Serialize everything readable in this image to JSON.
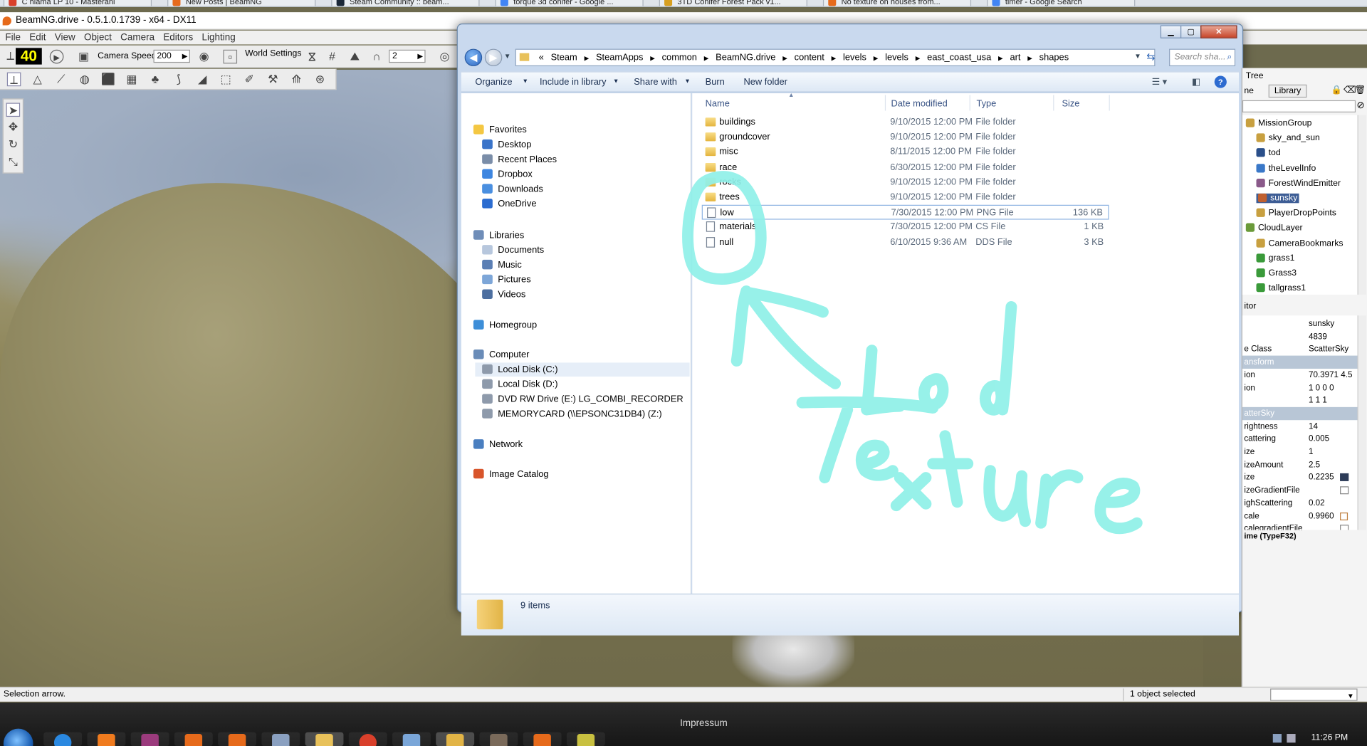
{
  "browser_tabs": [
    {
      "label": "C hlama LP 10 - Masterani",
      "color": "#d9402b"
    },
    {
      "label": "New Posts | BeamNG",
      "color": "#e66a1b"
    },
    {
      "label": "Steam Community :: beam...",
      "color": "#1b2838"
    },
    {
      "label": "torque 3d conifer - Google ...",
      "color": "#4285f4"
    },
    {
      "label": "3TD Conifer Forest Pack v1...",
      "color": "#d8a020"
    },
    {
      "label": "No texture on houses from...",
      "color": "#e66a1b"
    },
    {
      "label": "timer - Google Search",
      "color": "#4285f4"
    }
  ],
  "window": {
    "title": "BeamNG.drive - 0.5.1.0.1739 - x64 - DX11"
  },
  "menu": [
    "File",
    "Edit",
    "View",
    "Object",
    "Camera",
    "Editors",
    "Lighting"
  ],
  "toolbar": {
    "fps": "40",
    "camera_speed_label": "Camera Speed",
    "camera_speed_value": "200",
    "world_settings_label": "World Settings",
    "snap_value": "2"
  },
  "statusbar": {
    "left": "Selection arrow.",
    "right": "1 object selected"
  },
  "explorer": {
    "breadcrumb": [
      "«",
      "Steam",
      "SteamApps",
      "common",
      "BeamNG.drive",
      "content",
      "levels",
      "levels",
      "east_coast_usa",
      "art",
      "shapes"
    ],
    "search_placeholder": "Search sha...",
    "commands": [
      "Organize",
      "Include in library",
      "Share with",
      "Burn",
      "New folder"
    ],
    "nav": {
      "favorites_label": "Favorites",
      "favorites": [
        "Desktop",
        "Recent Places",
        "Dropbox",
        "Downloads",
        "OneDrive"
      ],
      "libraries_label": "Libraries",
      "libraries": [
        "Documents",
        "Music",
        "Pictures",
        "Videos"
      ],
      "homegroup": "Homegroup",
      "computer_label": "Computer",
      "drives": [
        "Local Disk (C:)",
        "Local Disk (D:)",
        "DVD RW Drive (E:) LG_COMBI_RECORDER",
        "MEMORYCARD (\\\\EPSONC31DB4) (Z:)"
      ],
      "network": "Network",
      "image_catalog": "Image Catalog"
    },
    "columns": [
      "Name",
      "Date modified",
      "Type",
      "Size"
    ],
    "files": [
      {
        "name": "buildings",
        "date": "9/10/2015 12:00 PM",
        "type": "File folder",
        "size": "",
        "kind": "folder"
      },
      {
        "name": "groundcover",
        "date": "9/10/2015 12:00 PM",
        "type": "File folder",
        "size": "",
        "kind": "folder"
      },
      {
        "name": "misc",
        "date": "8/11/2015 12:00 PM",
        "type": "File folder",
        "size": "",
        "kind": "folder"
      },
      {
        "name": "race",
        "date": "6/30/2015 12:00 PM",
        "type": "File folder",
        "size": "",
        "kind": "folder"
      },
      {
        "name": "rocks",
        "date": "9/10/2015 12:00 PM",
        "type": "File folder",
        "size": "",
        "kind": "folder"
      },
      {
        "name": "trees",
        "date": "9/10/2015 12:00 PM",
        "type": "File folder",
        "size": "",
        "kind": "folder"
      },
      {
        "name": "low",
        "date": "7/30/2015 12:00 PM",
        "type": "PNG File",
        "size": "136 KB",
        "kind": "file"
      },
      {
        "name": "materials",
        "date": "7/30/2015 12:00 PM",
        "type": "CS File",
        "size": "1 KB",
        "kind": "file"
      },
      {
        "name": "null",
        "date": "6/10/2015 9:36 AM",
        "type": "DDS File",
        "size": "3 KB",
        "kind": "file"
      }
    ],
    "item_count": "9 items"
  },
  "scene_tree": {
    "title": "Tree",
    "tabs": [
      "ne",
      "Library"
    ],
    "items": [
      "MissionGroup",
      "sky_and_sun",
      "tod",
      "theLevelInfo",
      "ForestWindEmitter",
      "sunsky",
      "PlayerDropPoints",
      "CloudLayer",
      "CameraBookmarks",
      "grass1",
      "Grass3",
      "tallgrass1"
    ]
  },
  "inspector": {
    "title": "itor",
    "rows": [
      {
        "k": "",
        "v": "sunsky"
      },
      {
        "k": "",
        "v": "4839"
      },
      {
        "k": "e Class",
        "v": "ScatterSky"
      },
      {
        "k": "ansform",
        "v": "",
        "header": true
      },
      {
        "k": "ion",
        "v": "70.3971 4.5"
      },
      {
        "k": "ion",
        "v": "1 0 0 0"
      },
      {
        "k": "",
        "v": "1 1 1"
      },
      {
        "k": "atterSky",
        "v": "",
        "header": true
      },
      {
        "k": "rightness",
        "v": "14"
      },
      {
        "k": "cattering",
        "v": "0.005"
      },
      {
        "k": "ize",
        "v": "1"
      },
      {
        "k": "izeAmount",
        "v": "2.5"
      },
      {
        "k": "ize",
        "v": "0.2235"
      },
      {
        "k": "izeGradientFile",
        "v": ""
      },
      {
        "k": "ighScattering",
        "v": "0.02"
      },
      {
        "k": "cale",
        "v": "0.9960"
      },
      {
        "k": "calegradientFile",
        "v": ""
      }
    ],
    "footer": "ime (TypeF32)"
  },
  "taskbar": {
    "impressum": "Impressum",
    "clock": "11:26 PM"
  },
  "annotation": {
    "text_line1": "Lod",
    "text_line2": "Texture",
    "color": "#8ff0e8"
  }
}
